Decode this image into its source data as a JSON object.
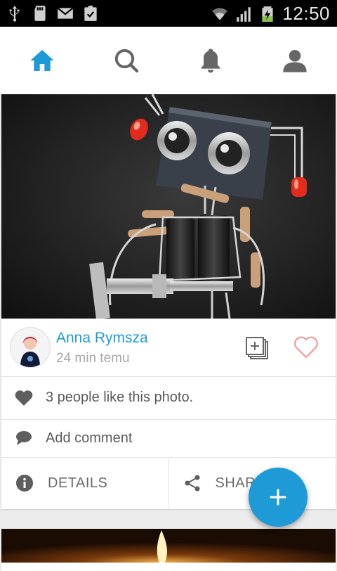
{
  "status_bar": {
    "time": "12:50"
  },
  "nav": {
    "tabs": [
      "home-icon",
      "search-icon",
      "bell-icon",
      "profile-icon"
    ],
    "active_color": "#1e9bd7"
  },
  "post": {
    "author_name": "Anna Rymsza",
    "time_ago": "24 min temu",
    "likes_text": "3 people like this photo.",
    "comment_placeholder": "Add comment",
    "details_label": "DETAILS",
    "share_label": "SHARE"
  },
  "colors": {
    "accent": "#1e9bd7",
    "heart": "#f49a9a"
  }
}
